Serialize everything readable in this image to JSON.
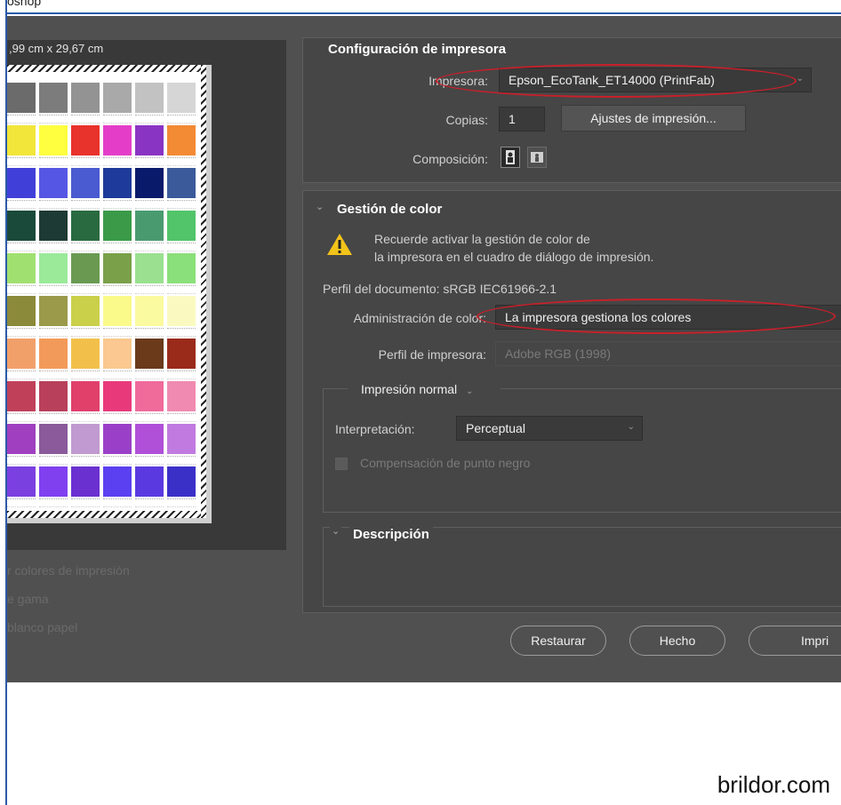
{
  "window": {
    "title": "oshop"
  },
  "preview": {
    "size_label": ",99 cm x 29,67 cm",
    "swatch_rows": [
      [
        "#6b6b6b",
        "#7c7c7c",
        "#939393",
        "#a9a9a9",
        "#c2c2c2",
        "#d6d6d6"
      ],
      [
        "#f2e63a",
        "#ffff40",
        "#e8322c",
        "#e43ec8",
        "#8a34c4",
        "#f38a34"
      ],
      [
        "#4040d8",
        "#5656e4",
        "#4a5ad0",
        "#1e3a9a",
        "#0a1a6a",
        "#3a5a9a"
      ],
      [
        "#1a4a3a",
        "#1e3a34",
        "#2a6a40",
        "#3a9a48",
        "#4a9a70",
        "#52c46a"
      ],
      [
        "#a0e070",
        "#9aea9a",
        "#6a9a52",
        "#7aa04a",
        "#9ae090",
        "#8ae07a"
      ],
      [
        "#8a8a3a",
        "#9a9a4a",
        "#cad04a",
        "#fafa8a",
        "#fafaa0",
        "#fafac0"
      ],
      [
        "#f2a06a",
        "#f29a5a",
        "#f2c04a",
        "#fac890",
        "#6a3a1a",
        "#9a2a1a"
      ],
      [
        "#c0405a",
        "#b8405a",
        "#e0406a",
        "#e83a7a",
        "#f06a9a",
        "#f08ab0"
      ],
      [
        "#a040c0",
        "#8a5a9a",
        "#c09ad0",
        "#9a40c8",
        "#b050d8",
        "#c07ae0"
      ],
      [
        "#7a40e0",
        "#8040f0",
        "#6a30d0",
        "#5a40f0",
        "#5a3ae0",
        "#3a30c8"
      ]
    ],
    "options": [
      "r colores de impresión",
      "e gama",
      "blanco papel"
    ]
  },
  "printer_setup": {
    "title": "Configuración de impresora",
    "printer_label": "Impresora:",
    "printer_value": "Epson_EcoTank_ET14000 (PrintFab)",
    "copies_label": "Copias:",
    "copies_value": "1",
    "print_settings_button": "Ajustes de impresión...",
    "layout_label": "Composición:"
  },
  "color_management": {
    "title": "Gestión de color",
    "warning_line1": "Recuerde activar la gestión de color de",
    "warning_line2": "la impresora en el cuadro de diálogo de impresión.",
    "document_profile": "Perfil del documento: sRGB IEC61966-2.1",
    "color_handling_label": "Administración de color:",
    "color_handling_value": "La impresora gestiona los colores",
    "printer_profile_label": "Perfil de impresora:",
    "printer_profile_value": "Adobe RGB (1998)",
    "print_mode": "Impresión normal",
    "rendering_intent_label": "Interpretación:",
    "rendering_intent_value": "Perceptual",
    "black_point_label": "Compensación de punto negro"
  },
  "description": {
    "title": "Descripción"
  },
  "buttons": {
    "reset": "Restaurar",
    "done": "Hecho",
    "print": "Impri"
  },
  "footer": {
    "watermark": "brildor.com"
  },
  "colors": {
    "annotation": "#c8202a",
    "dialog_bg": "#505050"
  }
}
